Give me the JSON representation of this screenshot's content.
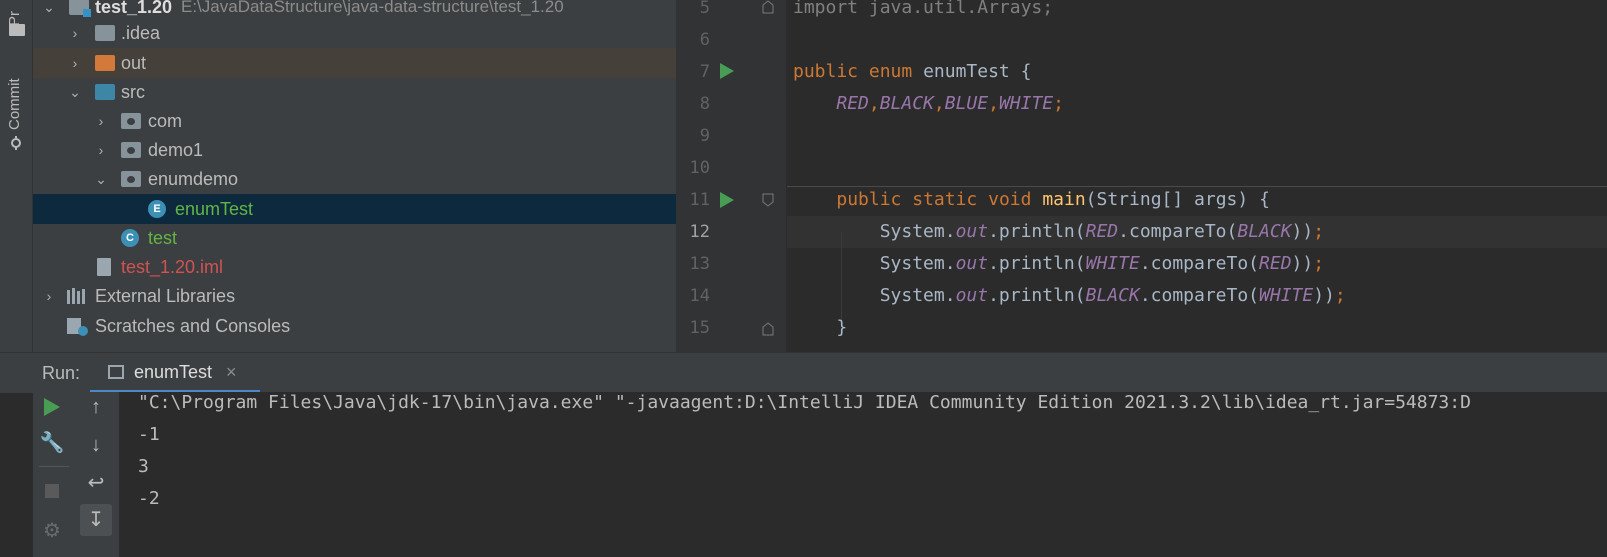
{
  "left_strip": {
    "project_tab": "Pr",
    "commit_tab": "Commit"
  },
  "project_tree": [
    {
      "label": "test_1.20",
      "path": "E:\\JavaDataStructure\\java-data-structure\\test_1.20",
      "icon": "module-icon",
      "level": 0,
      "expanded": true
    },
    {
      "label": ".idea",
      "icon": "folder-icon",
      "level": 1,
      "expanded": false
    },
    {
      "label": "out",
      "icon": "folder-orange-icon",
      "level": 1,
      "expanded": false
    },
    {
      "label": "src",
      "icon": "source-folder-icon",
      "level": 1,
      "expanded": true
    },
    {
      "label": "com",
      "icon": "package-icon",
      "level": 2,
      "expanded": false
    },
    {
      "label": "demo1",
      "icon": "package-icon",
      "level": 2,
      "expanded": false
    },
    {
      "label": "enumdemo",
      "icon": "package-icon",
      "level": 2,
      "expanded": true
    },
    {
      "label": "enumTest",
      "icon": "enum-class-icon",
      "badge": "E",
      "level": 3,
      "selected": true
    },
    {
      "label": "test",
      "icon": "class-icon",
      "badge": "C",
      "level": 2
    },
    {
      "label": "test_1.20.iml",
      "icon": "iml-file-icon",
      "level": 1
    },
    {
      "label": "External Libraries",
      "icon": "libraries-icon",
      "level": 0,
      "expanded": false
    },
    {
      "label": "Scratches and Consoles",
      "icon": "scratches-icon",
      "level": 0
    }
  ],
  "editor": {
    "line_numbers": [
      "5",
      "6",
      "7",
      "8",
      "9",
      "10",
      "11",
      "12",
      "13",
      "14",
      "15"
    ],
    "current_line": "12",
    "code": {
      "l5_import": "import",
      "l5_rest": " java.util.Arrays;",
      "l7_public": "public",
      "l7_enum": "enum",
      "l7_name": " enumTest {",
      "l8_red": "RED",
      "l8_black": "BLACK",
      "l8_blue": "BLUE",
      "l8_white": "WHITE",
      "comma": ",",
      "semi": ";",
      "l11_public": "public",
      "l11_static": "static",
      "l11_void": "void",
      "l11_main": "main",
      "l11_rest": "(String[] args) {",
      "sys": "System.",
      "out": "out",
      "println": ".println(",
      "compare": ".compareTo(",
      "close": "))",
      "l12_a": "RED",
      "l12_b": "BLACK",
      "l13_a": "WHITE",
      "l13_b": "RED",
      "l14_a": "BLACK",
      "l14_b": "WHITE",
      "l15": "}"
    }
  },
  "run_panel": {
    "label": "Run:",
    "tab": "enumTest",
    "close": "×",
    "console_lines": [
      "\"C:\\Program Files\\Java\\jdk-17\\bin\\java.exe\" \"-javaagent:D:\\IntelliJ IDEA Community Edition 2021.3.2\\lib\\idea_rt.jar=54873:D",
      "-1",
      "3",
      "-2"
    ]
  },
  "colors": {
    "keyword": "#cc7832",
    "enum_constant": "#9876aa",
    "method": "#ffc66d",
    "plain": "#a9b7c6",
    "selection": "#0d293e",
    "run_green": "#499c54"
  }
}
